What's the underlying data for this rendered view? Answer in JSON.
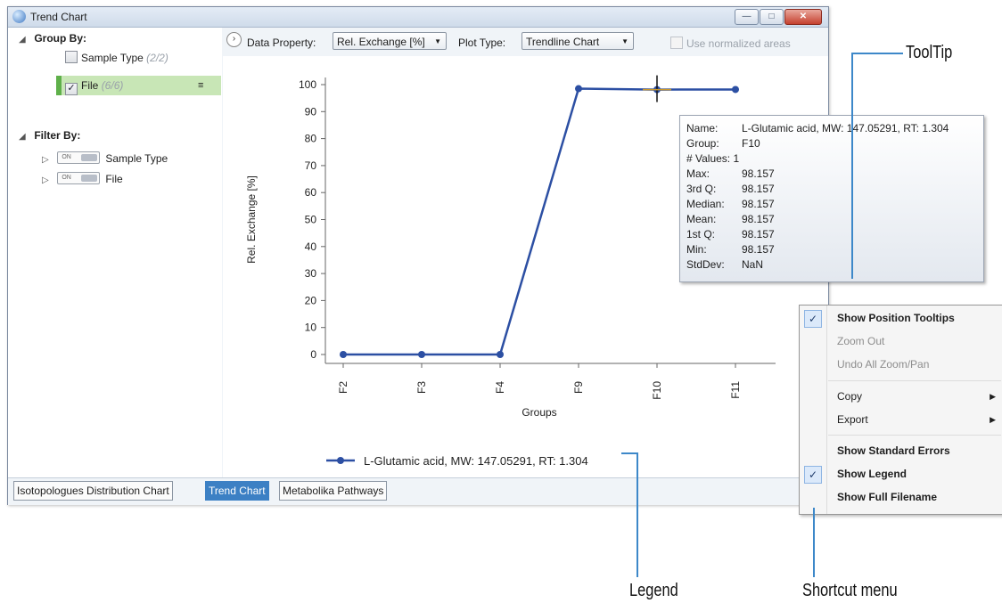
{
  "window": {
    "title": "Trend Chart",
    "min_glyph": "—",
    "max_glyph": "□",
    "close_glyph": "✕"
  },
  "left_panel": {
    "group_by": {
      "label": "Group By:",
      "items": [
        {
          "label": "Sample Type",
          "count": "(2/2)",
          "checked": false
        },
        {
          "label": "File",
          "count": "(6/6)",
          "checked": true
        }
      ]
    },
    "filter_by": {
      "label": "Filter By:",
      "items": [
        {
          "toggle": "ON",
          "label": "Sample Type"
        },
        {
          "toggle": "ON",
          "label": "File"
        }
      ]
    }
  },
  "toolbar": {
    "data_property_label": "Data Property:",
    "data_property_value": "Rel. Exchange [%]",
    "plot_type_label": "Plot Type:",
    "plot_type_value": "Trendline Chart",
    "normalized_label": "Use normalized areas"
  },
  "chart_data": {
    "type": "line",
    "title": "",
    "xlabel": "Groups",
    "ylabel": "Rel. Exchange [%]",
    "categories": [
      "F2",
      "F3",
      "F4",
      "F9",
      "F10",
      "F11"
    ],
    "ylim": [
      0,
      100
    ],
    "yticks": [
      0,
      10,
      20,
      30,
      40,
      50,
      60,
      70,
      80,
      90,
      100
    ],
    "grid": false,
    "legend_position": "bottom",
    "series": [
      {
        "name": "L-Glutamic acid, MW: 147.05291, RT: 1.304",
        "color": "#2c4fa3",
        "values": [
          0,
          0,
          0,
          98.5,
          98.157,
          98.2
        ]
      }
    ]
  },
  "tooltip": {
    "rows": [
      {
        "key": "Name:",
        "value": "L-Glutamic acid, MW: 147.05291, RT: 1.304"
      },
      {
        "key": "Group:",
        "value": "F10"
      },
      {
        "key": "# Values: 1",
        "value": ""
      },
      {
        "key": "Max:",
        "value": "98.157"
      },
      {
        "key": "3rd Q:",
        "value": "98.157"
      },
      {
        "key": "Median:",
        "value": "98.157"
      },
      {
        "key": "Mean:",
        "value": "98.157"
      },
      {
        "key": "1st Q:",
        "value": "98.157"
      },
      {
        "key": "Min:",
        "value": "98.157"
      },
      {
        "key": "StdDev:",
        "value": "NaN"
      }
    ]
  },
  "context_menu": {
    "items": [
      {
        "label": "Show Position Tooltips",
        "checked": true,
        "bold": true
      },
      {
        "label": "Zoom Out",
        "disabled": true
      },
      {
        "label": "Undo All Zoom/Pan",
        "disabled": true
      },
      {
        "label": "Copy",
        "submenu": true
      },
      {
        "label": "Export",
        "submenu": true
      },
      {
        "label": "Show Standard Errors",
        "bold": true
      },
      {
        "label": "Show Legend",
        "checked": true,
        "bold": true
      },
      {
        "label": "Show Full Filename",
        "bold": true
      }
    ]
  },
  "tabs": [
    "Isotopologues Distribution Chart",
    "Trend Chart",
    "Metabolika Pathways"
  ],
  "active_tab": "Trend Chart",
  "callouts": {
    "tooltip": "ToolTip",
    "legend": "Legend",
    "shortcut_menu": "Shortcut menu"
  },
  "colors": {
    "accent": "#3c80c4",
    "selected_row": "#c8e6b6",
    "callout_line": "#3d88c9",
    "series": "#2c4fa3"
  }
}
